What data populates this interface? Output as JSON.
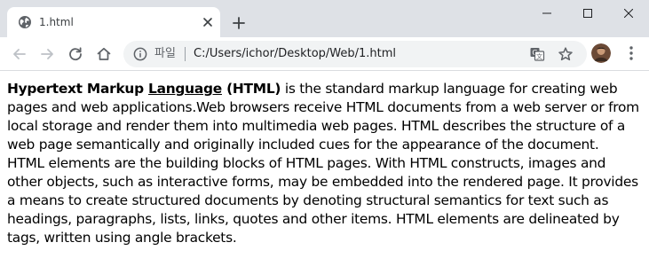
{
  "tab": {
    "title": "1.html",
    "favicon": "globe-icon",
    "close": "close-icon"
  },
  "newtab": {
    "icon": "plus-icon"
  },
  "window_controls": {
    "minimize": "minimize-icon",
    "maximize": "maximize-icon",
    "close": "close-icon"
  },
  "toolbar": {
    "back": "back-arrow-icon",
    "forward": "forward-arrow-icon",
    "reload": "reload-icon",
    "home": "home-icon"
  },
  "omnibox": {
    "info_icon": "info-icon",
    "scheme_label": "파일",
    "url": "C:/Users/ichor/Desktop/Web/1.html",
    "translate_icon": "translate-icon",
    "bookmark_icon": "star-icon"
  },
  "profile": {
    "icon": "avatar"
  },
  "menu": {
    "icon": "kebab-menu-icon"
  },
  "colors": {
    "tabstrip_bg": "#dee1e6",
    "omnibox_bg": "#f1f3f4",
    "icon": "#5f6368",
    "text": "#000000"
  },
  "page": {
    "p1_bold_1": "Hypertext Markup ",
    "p1_bold_underline": "Language",
    "p1_bold_2": " (HTML)",
    "p1_rest": " is the standard markup language for creating web pages and web applications.Web browsers receive HTML documents from a web server or from local storage and render them into multimedia web pages. HTML describes the structure of a web page semantically and originally included cues for the appearance of the document.",
    "p2": "HTML elements are the building blocks of HTML pages. With HTML constructs, images and other objects, such as interactive forms, may be embedded into the rendered page. It provides a means to create structured documents by denoting structural semantics for text such as headings, paragraphs, lists, links, quotes and other items. HTML elements are delineated by tags, written using angle brackets."
  }
}
